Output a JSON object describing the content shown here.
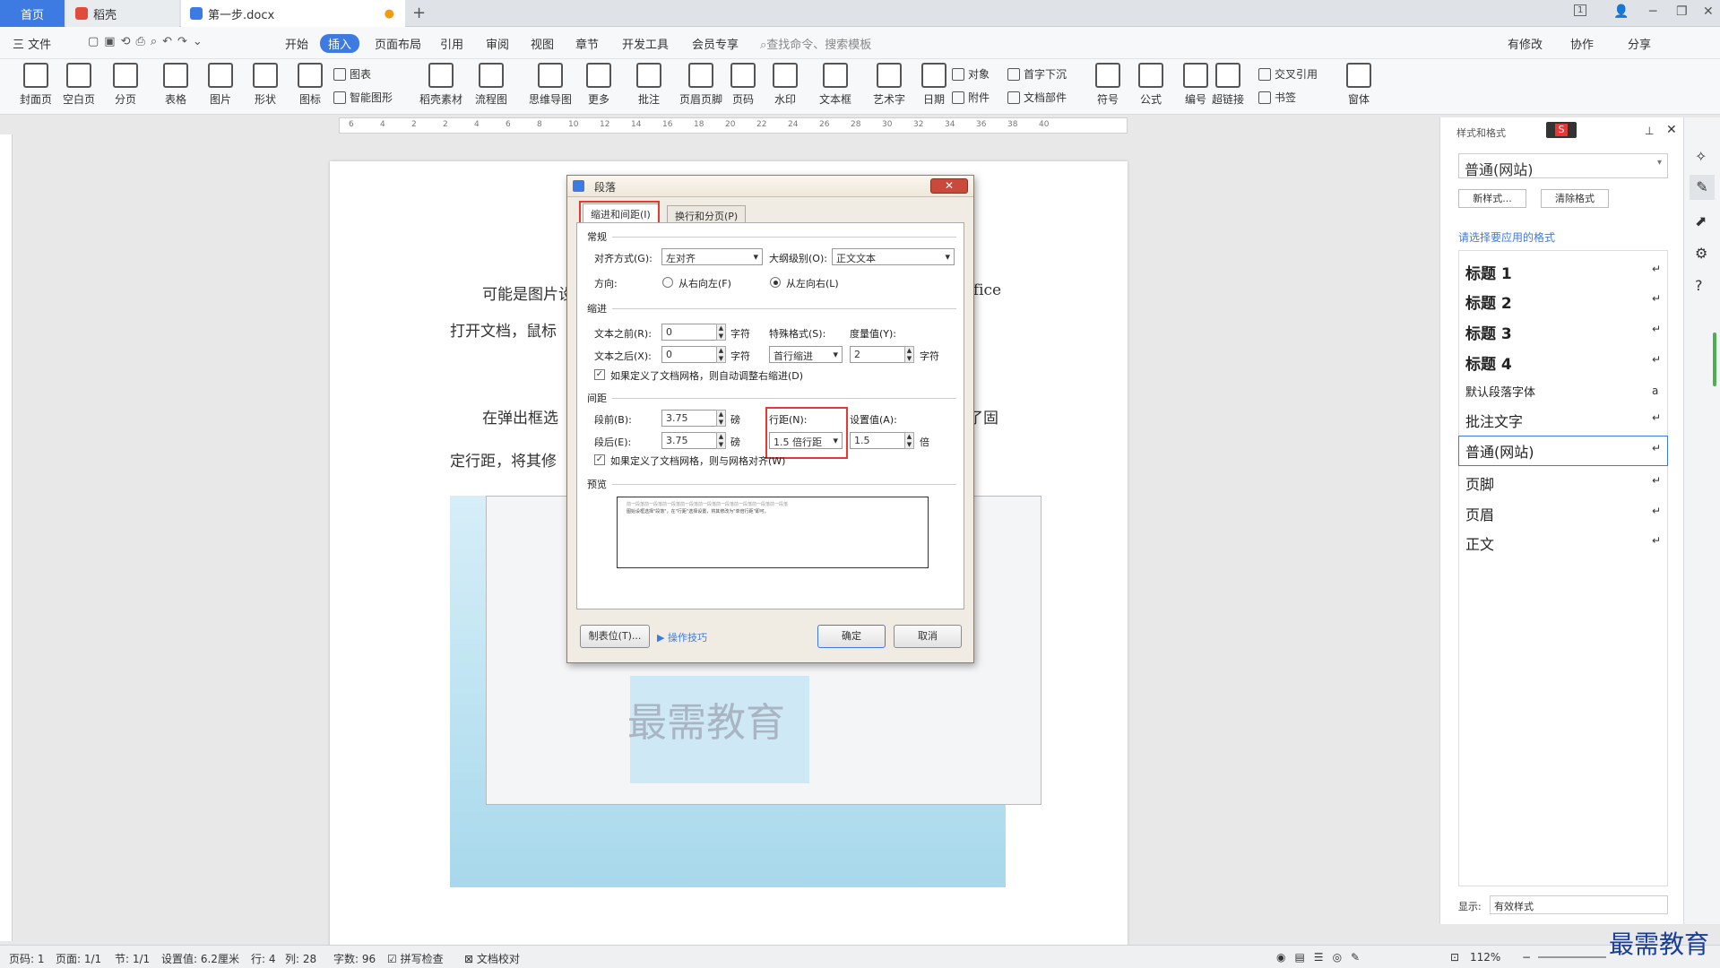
{
  "titlebar": {
    "tabs": [
      {
        "label": "首页"
      },
      {
        "label": "稻壳"
      },
      {
        "label": "第一步.docx"
      }
    ],
    "new_tab": "+",
    "page_indicator": "1"
  },
  "menu": {
    "file": "三 文件",
    "items": [
      "开始",
      "插入",
      "页面布局",
      "引用",
      "审阅",
      "视图",
      "章节",
      "开发工具",
      "会员专享"
    ],
    "search_placeholder": "查找命令、搜索模板",
    "right": [
      "有修改",
      "协作",
      "分享"
    ]
  },
  "ribbon": {
    "big": [
      "封面页",
      "空白页",
      "分页",
      "表格",
      "图片",
      "形状",
      "图标",
      "稻壳素材",
      "流程图",
      "思维导图",
      "更多",
      "批注",
      "页眉页脚",
      "页码",
      "水印",
      "文本框",
      "艺术字",
      "日期",
      "符号",
      "公式",
      "编号",
      "超链接",
      "窗体"
    ],
    "small": [
      "图表",
      "智能图形",
      "对象",
      "附件",
      "首字下沉",
      "文档部件",
      "交叉引用",
      "书签"
    ]
  },
  "ruler": {
    "ticks": [
      "6",
      "4",
      "2",
      "2",
      "4",
      "6",
      "8",
      "10",
      "12",
      "14",
      "16",
      "18",
      "20",
      "22",
      "24",
      "26",
      "28",
      "30",
      "32",
      "34",
      "36",
      "38",
      "40"
    ]
  },
  "document": {
    "line1": "可能是图片设",
    "line1_end": "ffice",
    "line2": "打开文档，鼠标",
    "line3": "在弹出框选",
    "line3_end": "了固",
    "line4": "定行距，将其修",
    "watermark": "最需教育"
  },
  "dialog": {
    "title": "段落",
    "tabs": [
      "缩进和间距(I)",
      "换行和分页(P)"
    ],
    "general": "常规",
    "align_label": "对齐方式(G):",
    "align_value": "左对齐",
    "outline_label": "大纲级别(O):",
    "outline_value": "正文文本",
    "direction_label": "方向:",
    "dir_rtl": "从右向左(F)",
    "dir_ltr": "从左向右(L)",
    "indent": "缩进",
    "before_text_label": "文本之前(R):",
    "before_text_value": "0",
    "after_text_label": "文本之后(X):",
    "after_text_value": "0",
    "unit_char": "字符",
    "special_label": "特殊格式(S):",
    "special_value": "首行缩进",
    "measure_label": "度量值(Y):",
    "measure_value": "2",
    "auto_indent": "如果定义了文档网格，则自动调整右缩进(D)",
    "spacing": "间距",
    "before_label": "段前(B):",
    "before_value": "3.75",
    "after_label": "段后(E):",
    "after_value": "3.75",
    "unit_pt": "磅",
    "line_label": "行距(N):",
    "line_value": "1.5 倍行距",
    "set_label": "设置值(A):",
    "set_value": "1.5",
    "unit_times": "倍",
    "grid_align": "如果定义了文档网格，则与网格对齐(W)",
    "preview": "预览",
    "preview_text": "前一段落前一段落前一段落前一段落前一段落前一段落前一段落前一段落前一段落",
    "preview_sample": "图始设框选择\"段落\"，在\"行距\"选择设置，将其修改为\"单倍行距\"即可。",
    "tab_stops": "制表位(T)...",
    "tips": "操作技巧",
    "ok": "确定",
    "cancel": "取消"
  },
  "panel": {
    "header": "样式和格式",
    "current": "普通(网站)",
    "new_style": "新样式...",
    "clear_format": "清除格式",
    "choose": "请选择要应用的格式",
    "styles": [
      "标题 1",
      "标题 2",
      "标题 3",
      "标题 4",
      "默认段落字体",
      "批注文字",
      "普通(网站)",
      "页脚",
      "页眉",
      "正文"
    ],
    "show_label": "显示:",
    "show_value": "有效样式"
  },
  "status": {
    "page": "页码: 1",
    "pages": "页面: 1/1",
    "section": "节: 1/1",
    "setting": "设置值: 6.2厘米",
    "row": "行: 4",
    "col": "列: 28",
    "words": "字数: 96",
    "spell": "拼写检查",
    "proof": "文档校对",
    "zoom": "112%"
  },
  "brand": "最需教育",
  "colors": {
    "accent": "#3d7be2",
    "highlight": "#e53935"
  }
}
